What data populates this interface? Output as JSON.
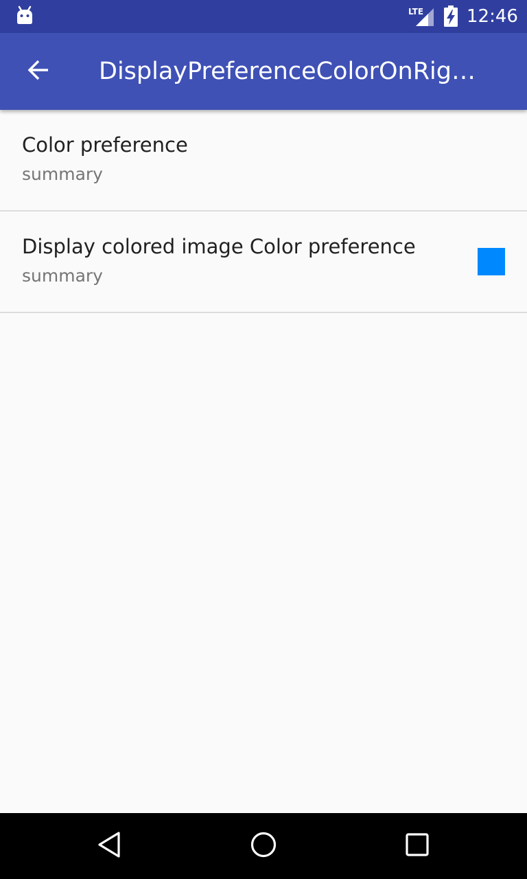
{
  "status_bar": {
    "time": "12:46",
    "network_label": "LTE",
    "icons": [
      "android-icon",
      "lte-signal-icon",
      "battery-charging-icon"
    ]
  },
  "app_bar": {
    "title": "DisplayPreferenceColorOnRig…",
    "back_icon": "arrow-back-icon"
  },
  "preferences": [
    {
      "title": "Color preference",
      "summary": "summary"
    },
    {
      "title": "Display colored image Color preference",
      "summary": "summary",
      "color": "#0088ff"
    }
  ],
  "nav_bar": {
    "icons": [
      "nav-back-icon",
      "nav-home-icon",
      "nav-recents-icon"
    ]
  },
  "colors": {
    "status_bar": "#303f9f",
    "app_bar": "#3f51b5",
    "background": "#fafafa",
    "swatch": "#0088ff"
  }
}
